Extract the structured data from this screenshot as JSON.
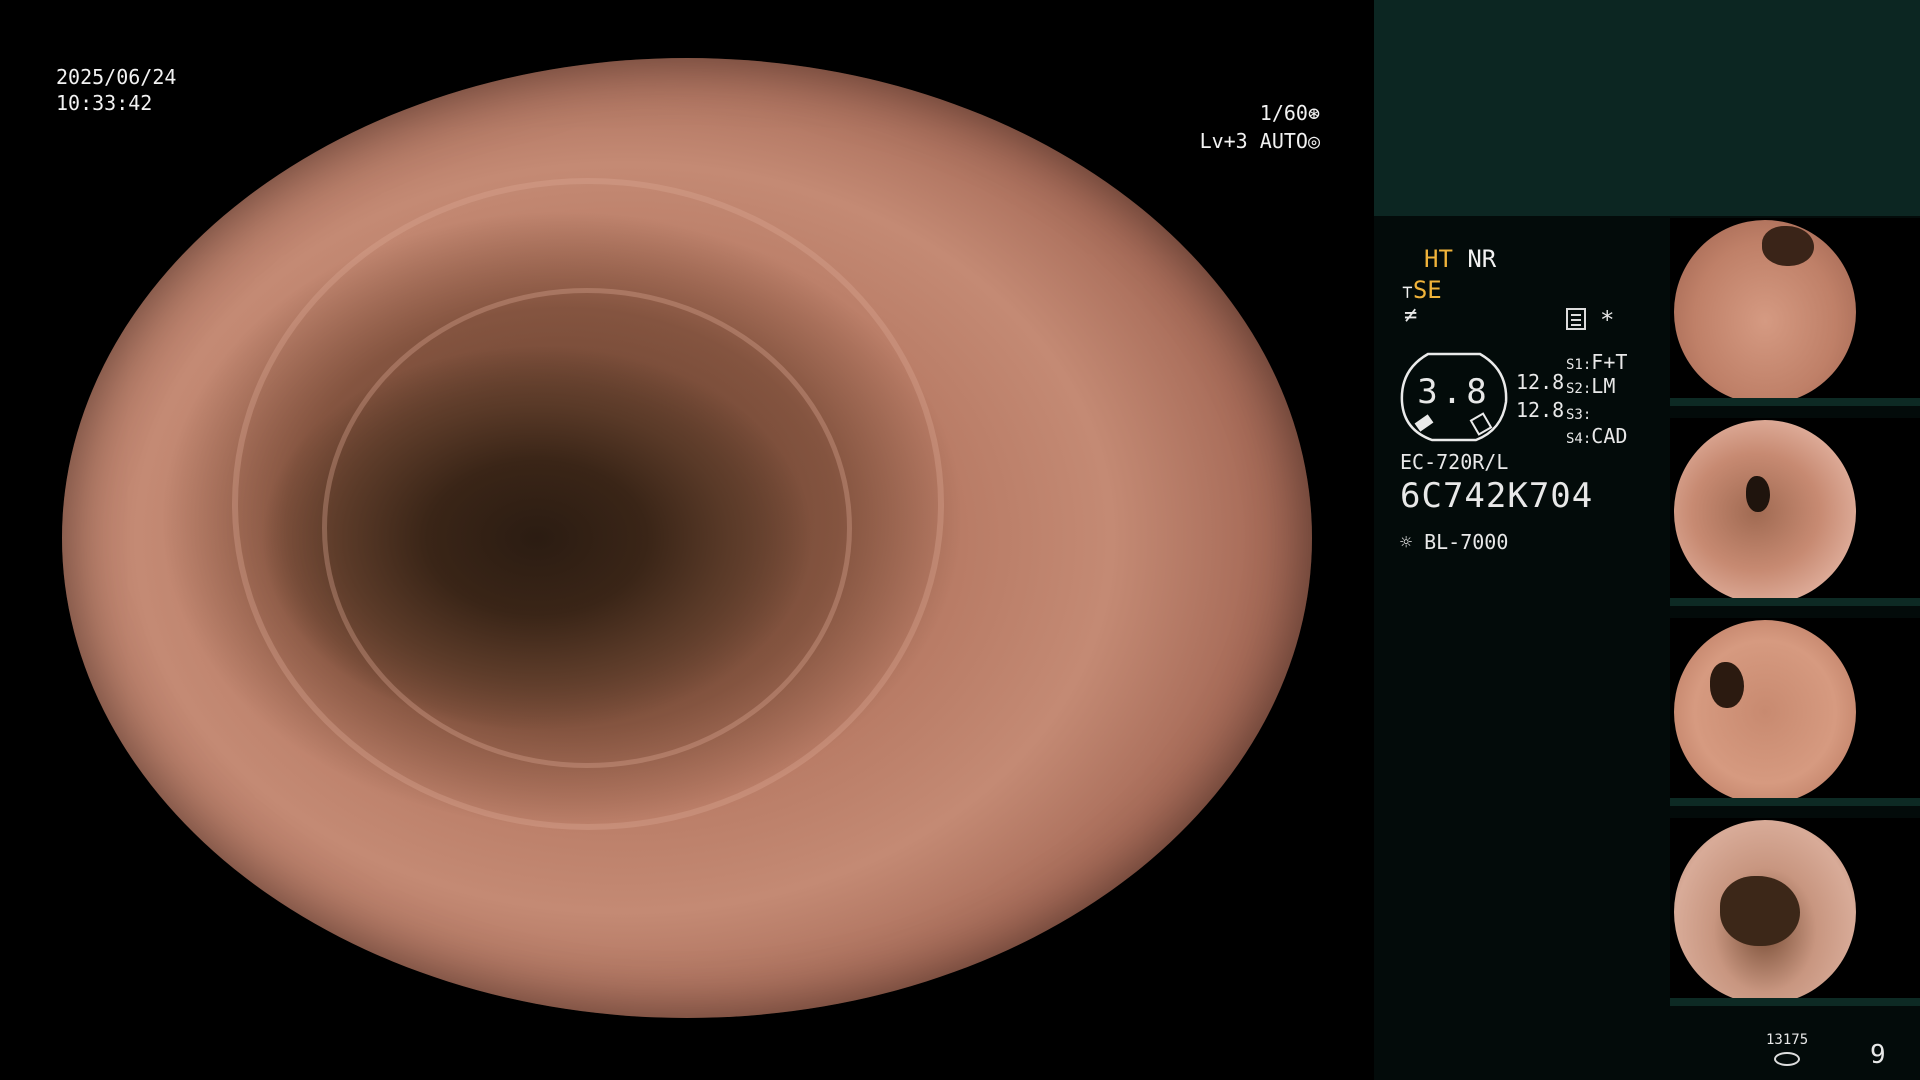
{
  "overlay": {
    "date": "2025/06/24",
    "time": "10:33:42",
    "shutter": "1/60",
    "shutter_icon": "shutter-icon",
    "level": "Lv+3",
    "mode": "AUTO",
    "mode_icon": "iris-icon"
  },
  "panel": {
    "ht": "HT",
    "nr": "NR",
    "se": "SE",
    "gauge_value": "3.8",
    "gauge_sub1": "12.8",
    "gauge_sub2": "12.8",
    "switches": [
      {
        "key": "S1",
        "value": "F+T"
      },
      {
        "key": "S2",
        "value": "LM"
      },
      {
        "key": "S3",
        "value": ""
      },
      {
        "key": "S4",
        "value": "CAD"
      }
    ],
    "scope_model": "EC-720R/L",
    "scope_serial": "6C742K704",
    "light_source": "BL-7000",
    "counter": "13175",
    "page": "9"
  },
  "colors": {
    "panel_bg": "#030b0a",
    "panel_top": "#0c2622",
    "accent_yellow": "#f0b33a",
    "tissue": "#b97c66"
  }
}
